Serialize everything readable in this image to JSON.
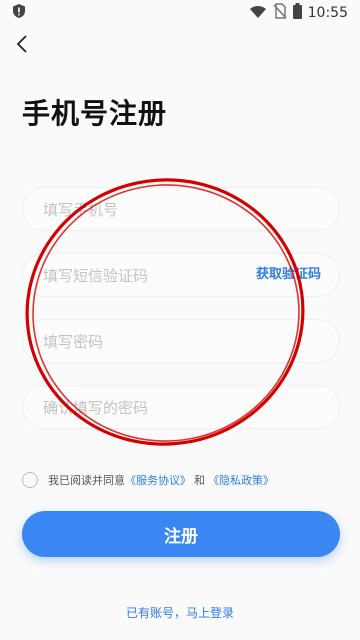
{
  "status_bar": {
    "time": "10:55",
    "icons": [
      "shield-alert-icon",
      "wifi-icon",
      "no-sim-icon",
      "battery-icon"
    ]
  },
  "header": {
    "back_icon": "chevron-left-icon",
    "title": "手机号注册"
  },
  "form": {
    "phone_placeholder": "填写手机号",
    "code_placeholder": "填写短信验证码",
    "get_code_label": "获取验证码",
    "password_placeholder": "填写密码",
    "confirm_placeholder": "确认填写的密码"
  },
  "agreement": {
    "prefix": "我已阅读并同意",
    "service_link": "《服务协议》",
    "and": "和",
    "privacy_link": "《隐私政策》"
  },
  "register_button": "注册",
  "login_link": "已有账号，马上登录",
  "colors": {
    "accent": "#3a86f3",
    "link": "#2e7de8",
    "annotation_circle": "#d40000"
  }
}
